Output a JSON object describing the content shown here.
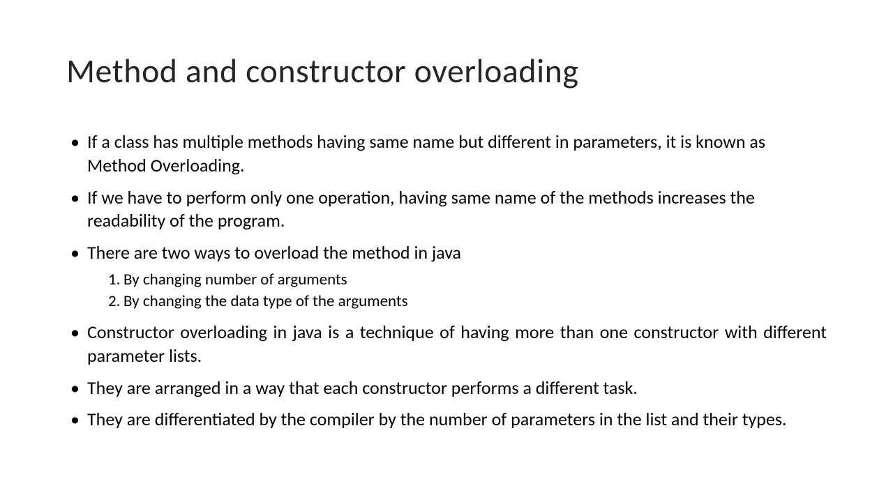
{
  "title": "Method and constructor overloading",
  "bullets": [
    {
      "text": "If a class has multiple methods having same name but different in parameters, it is known as Method Overloading.",
      "justify": false
    },
    {
      "text": "If we have to perform only one operation, having same name of the methods increases the readability of the program.",
      "justify": false
    },
    {
      "text": "There are two ways to overload the method in java",
      "justify": false,
      "subitems": [
        "By changing number of arguments",
        "By changing the data type of the arguments"
      ]
    },
    {
      "text": "Constructor overloading in java is a technique of having more than one constructor with different parameter lists.",
      "justify": true
    },
    {
      "text": "They are arranged in a way that each constructor performs a different task.",
      "justify": false
    },
    {
      "text": "They are differentiated by the compiler by the number of parameters in the list and their types.",
      "justify": true
    }
  ]
}
